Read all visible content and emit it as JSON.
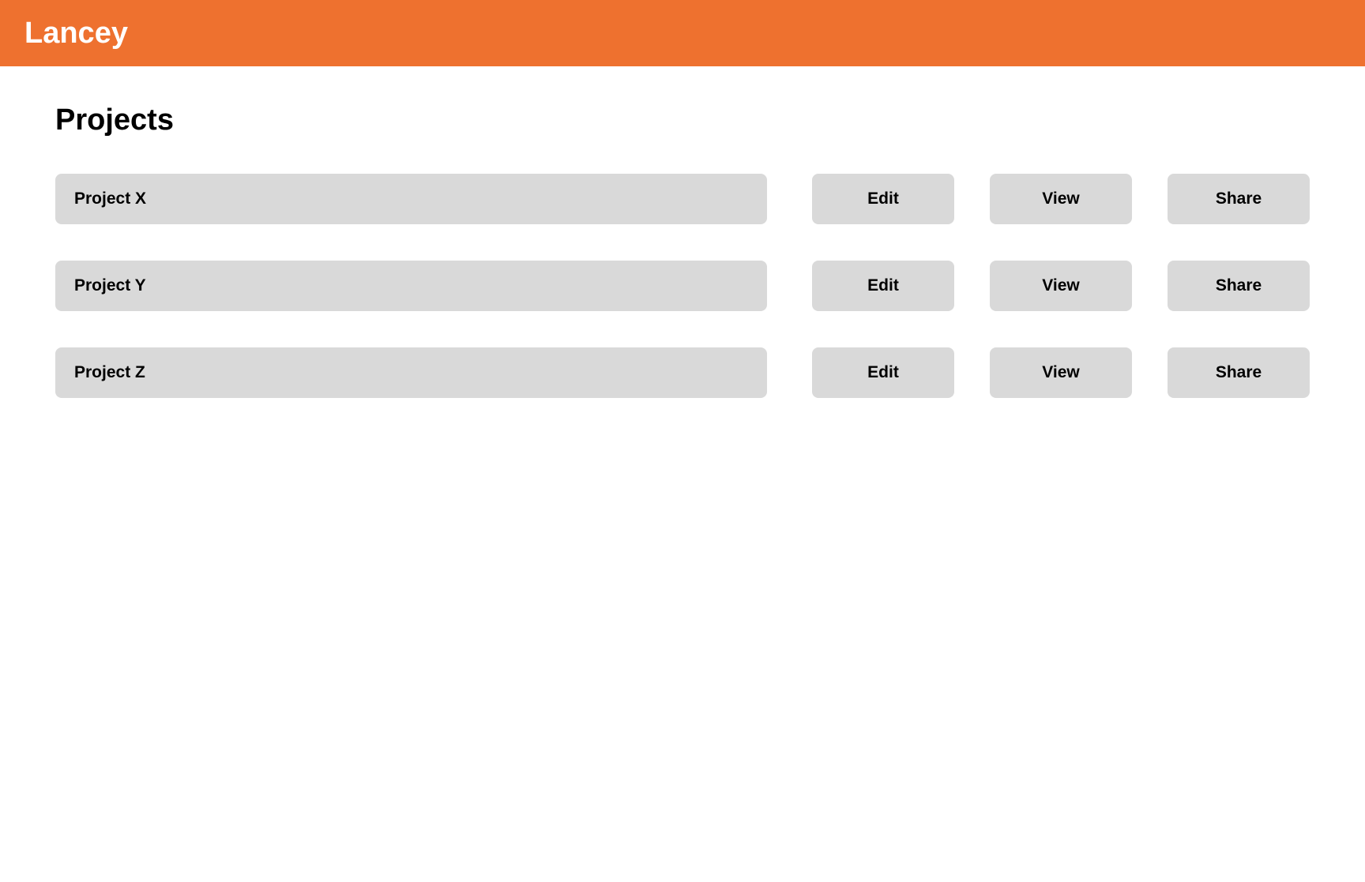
{
  "header": {
    "brand": "Lancey",
    "accent_color": "#ee712f"
  },
  "page": {
    "title": "Projects"
  },
  "projects": [
    {
      "name": "Project X",
      "actions": {
        "edit": "Edit",
        "view": "View",
        "share": "Share"
      }
    },
    {
      "name": "Project Y",
      "actions": {
        "edit": "Edit",
        "view": "View",
        "share": "Share"
      }
    },
    {
      "name": "Project Z",
      "actions": {
        "edit": "Edit",
        "view": "View",
        "share": "Share"
      }
    }
  ],
  "colors": {
    "row_background": "#d9d9d9",
    "text": "#000000",
    "header_text": "#ffffff"
  }
}
